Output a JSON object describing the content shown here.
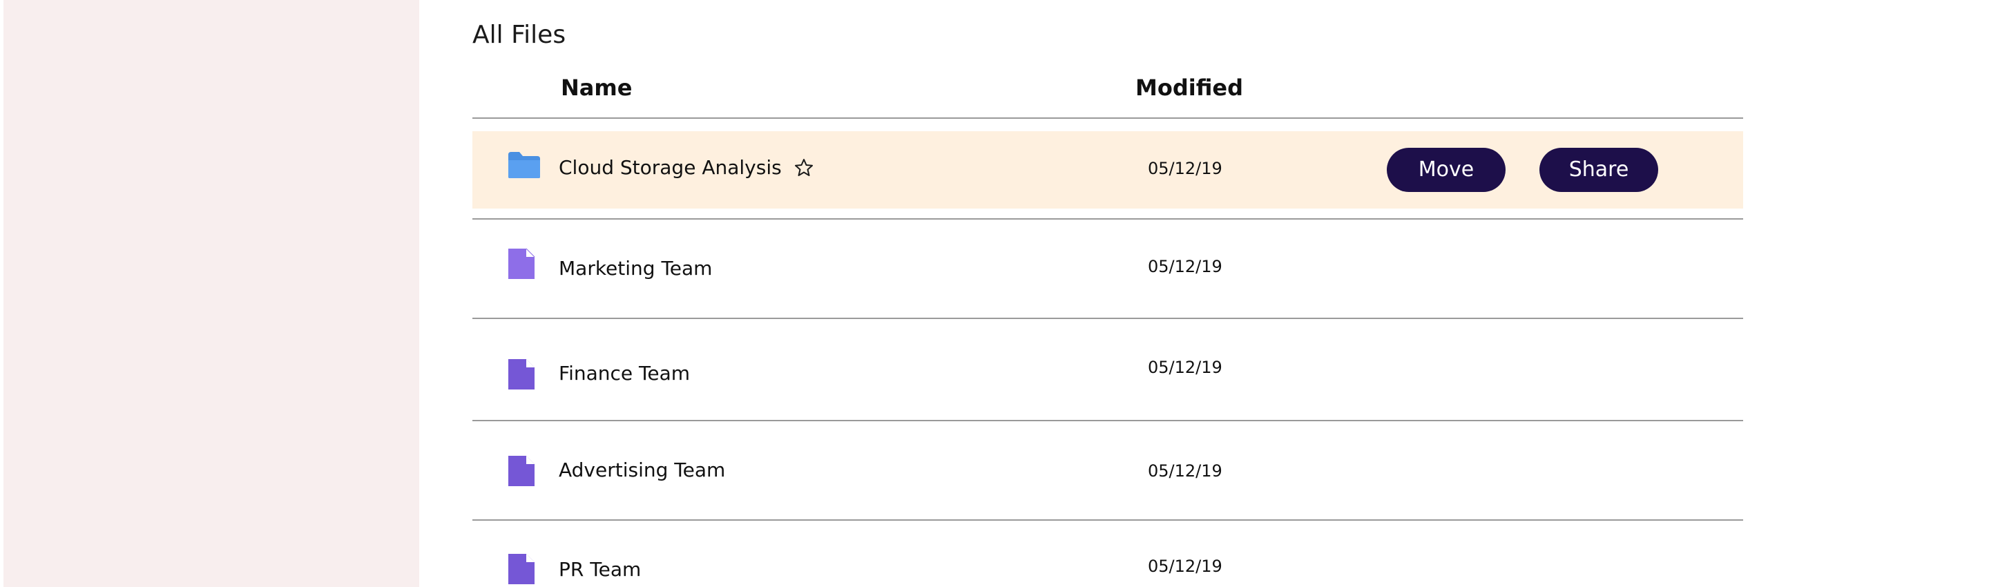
{
  "main": {
    "title": "All Files",
    "columns": {
      "name": "Name",
      "modified": "Modified"
    },
    "rows": [
      {
        "name": "Cloud Storage Analysis",
        "modified": "05/12/19",
        "type": "folder",
        "icon": "folder-icon",
        "icon_color": "#4a90e2",
        "selected": true,
        "starred_icon": "star-outline-icon",
        "actions": {
          "move": "Move",
          "share": "Share"
        }
      },
      {
        "name": "Marketing Team",
        "modified": "05/12/19",
        "type": "file",
        "icon": "file-icon",
        "icon_color": "#8e6ee8"
      },
      {
        "name": "Finance Team",
        "modified": "05/12/19",
        "type": "file",
        "icon": "file-icon",
        "icon_color": "#7557d6"
      },
      {
        "name": "Advertising Team",
        "modified": "05/12/19",
        "type": "file",
        "icon": "file-icon",
        "icon_color": "#7557d6"
      },
      {
        "name": "PR Team",
        "modified": "05/12/19",
        "type": "file",
        "icon": "file-icon",
        "icon_color": "#7557d6"
      }
    ]
  },
  "colors": {
    "sidebar_bg": "#f8eeee",
    "selected_row_bg": "#fef0df",
    "button_bg": "#1d0f4a",
    "button_text": "#ffffff",
    "divider": "#9a9a9a"
  }
}
